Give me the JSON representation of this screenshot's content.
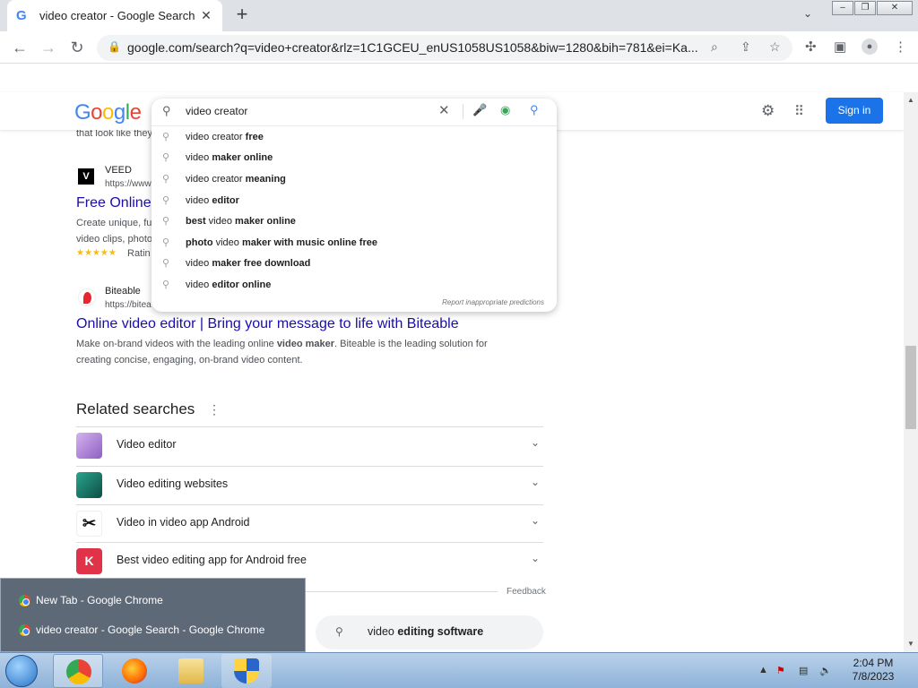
{
  "browser": {
    "tab_title": "video creator - Google Search",
    "new_tab_symbol": "+",
    "url": "google.com/search?q=video+creator&rlz=1C1GCEU_enUS1058US1058&biw=1280&bih=781&ei=Ka..."
  },
  "google": {
    "logo_letters": [
      "G",
      "o",
      "o",
      "g",
      "l",
      "e"
    ],
    "signin_label": "Sign in"
  },
  "search": {
    "query": "video creator",
    "suggestions": [
      {
        "plain": "video creator ",
        "bold": "free"
      },
      {
        "plain": "video ",
        "bold": "maker online"
      },
      {
        "plain": "video creator ",
        "bold": "meaning"
      },
      {
        "plain": "video ",
        "bold": "editor"
      },
      {
        "bold_first": "best",
        "plain": " video ",
        "bold": "maker online"
      },
      {
        "bold_first": "photo",
        "plain": " video ",
        "bold": "maker with music online free"
      },
      {
        "plain": "video ",
        "bold": "maker free download"
      },
      {
        "plain": "video ",
        "bold": "editor online"
      }
    ],
    "report_text": "Report inappropriate predictions"
  },
  "results": {
    "partial_snippet": "that look like they",
    "veed": {
      "site_name": "VEED",
      "url_partial": "https://www",
      "title_partial": "Free Online",
      "snippet_line1": "Create unique, fu",
      "snippet_line2": "video clips, photo",
      "rating_partial": "Ratin",
      "stars": "★★★★★"
    },
    "biteable": {
      "site_name": "Biteable",
      "url_partial": "https://bitea",
      "title": "Online video editor | Bring your message to life with Biteable",
      "snippet_a": "Make on-brand videos with the leading online ",
      "snippet_bold": "video maker",
      "snippet_b": ". Biteable is the leading solution for",
      "snippet_line2": "creating concise, engaging, on-brand video content."
    }
  },
  "related": {
    "title": "Related searches",
    "items": [
      {
        "label": "Video editor",
        "color": "#b58ad6"
      },
      {
        "label": "Video editing websites",
        "color": "#1e7a6a"
      },
      {
        "label": "Video in video app Android",
        "color": "#ffffff"
      },
      {
        "label": "Best video editing app for Android free",
        "color": "#e0334a"
      }
    ],
    "feedback": "Feedback",
    "pill_plain": "video ",
    "pill_bold": "editing software"
  },
  "taskbar_popup": {
    "items": [
      "New Tab - Google Chrome",
      "video creator - Google Search - Google Chrome"
    ]
  },
  "taskbar": {
    "time": "2:04 PM",
    "date": "7/8/2023"
  }
}
